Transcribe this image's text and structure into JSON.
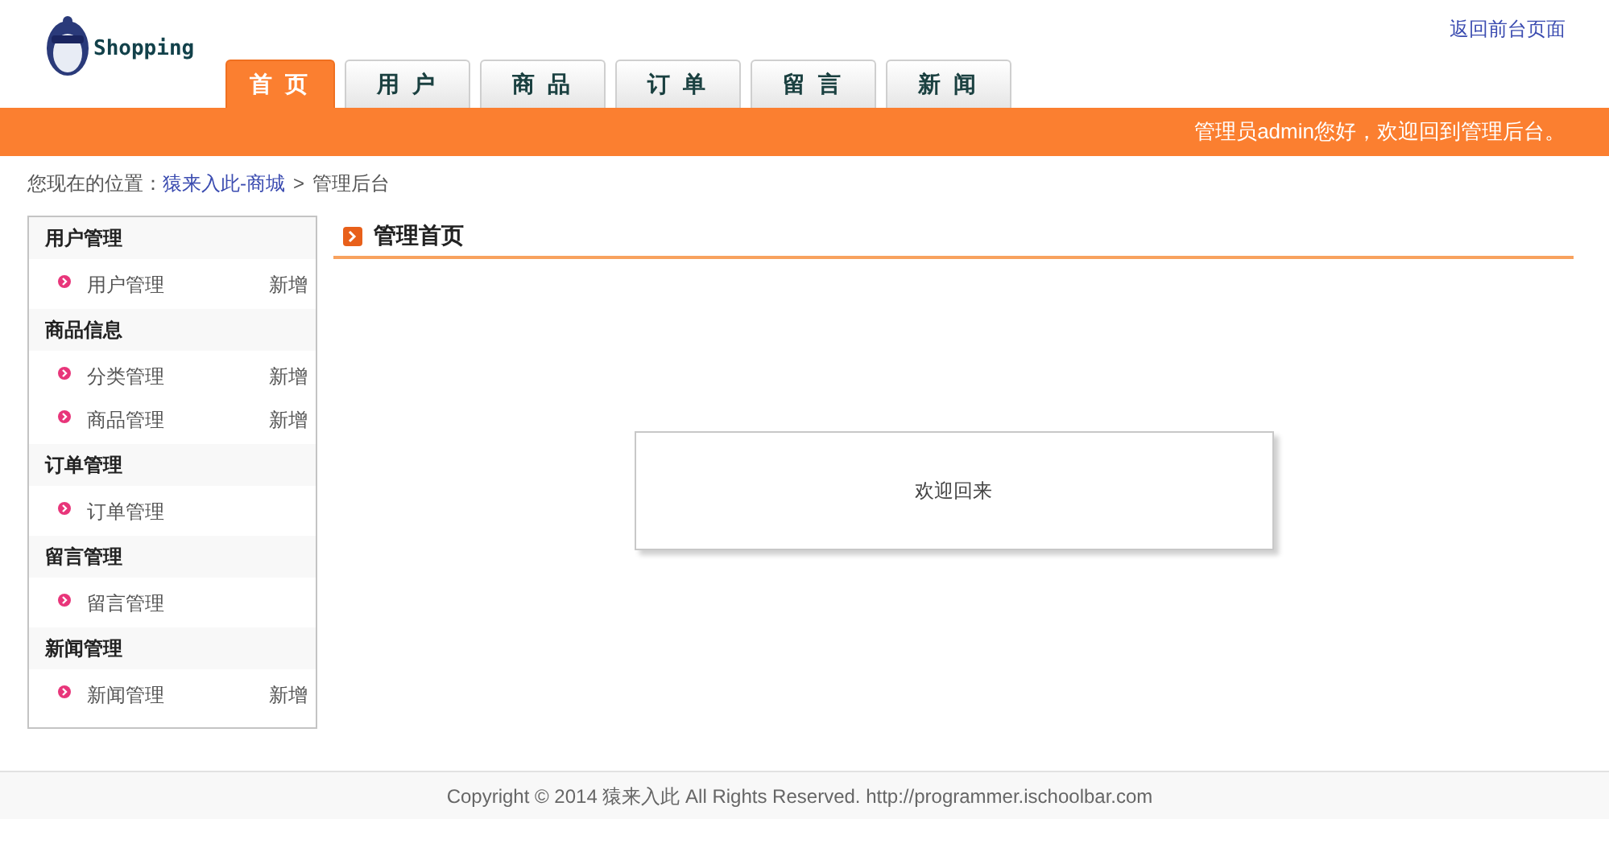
{
  "header": {
    "logo_text": "Shopping",
    "top_link": "返回前台页面"
  },
  "tabs": [
    {
      "label": "首 页",
      "selected": true
    },
    {
      "label": "用 户",
      "selected": false
    },
    {
      "label": "商 品",
      "selected": false
    },
    {
      "label": "订 单",
      "selected": false
    },
    {
      "label": "留 言",
      "selected": false
    },
    {
      "label": "新 闻",
      "selected": false
    }
  ],
  "banner": {
    "greeting": "管理员admin您好，欢迎回到管理后台。"
  },
  "breadcrumb": {
    "prefix": "您现在的位置：",
    "link": "猿来入此-商城",
    "separator": ">",
    "current": "管理后台"
  },
  "sidebar": {
    "groups": [
      {
        "title": "用户管理",
        "items": [
          {
            "label": "用户管理",
            "action": "新增"
          }
        ]
      },
      {
        "title": "商品信息",
        "items": [
          {
            "label": "分类管理",
            "action": "新增"
          },
          {
            "label": "商品管理",
            "action": "新增"
          }
        ]
      },
      {
        "title": "订单管理",
        "items": [
          {
            "label": "订单管理"
          }
        ]
      },
      {
        "title": "留言管理",
        "items": [
          {
            "label": "留言管理"
          }
        ]
      },
      {
        "title": "新闻管理",
        "items": [
          {
            "label": "新闻管理",
            "action": "新增"
          }
        ]
      }
    ]
  },
  "main": {
    "title": "管理首页",
    "message": "欢迎回来"
  },
  "footer": {
    "copyright": "Copyright © 2014 猿来入此 All Rights Reserved. http://programmer.ischoolbar.com"
  }
}
